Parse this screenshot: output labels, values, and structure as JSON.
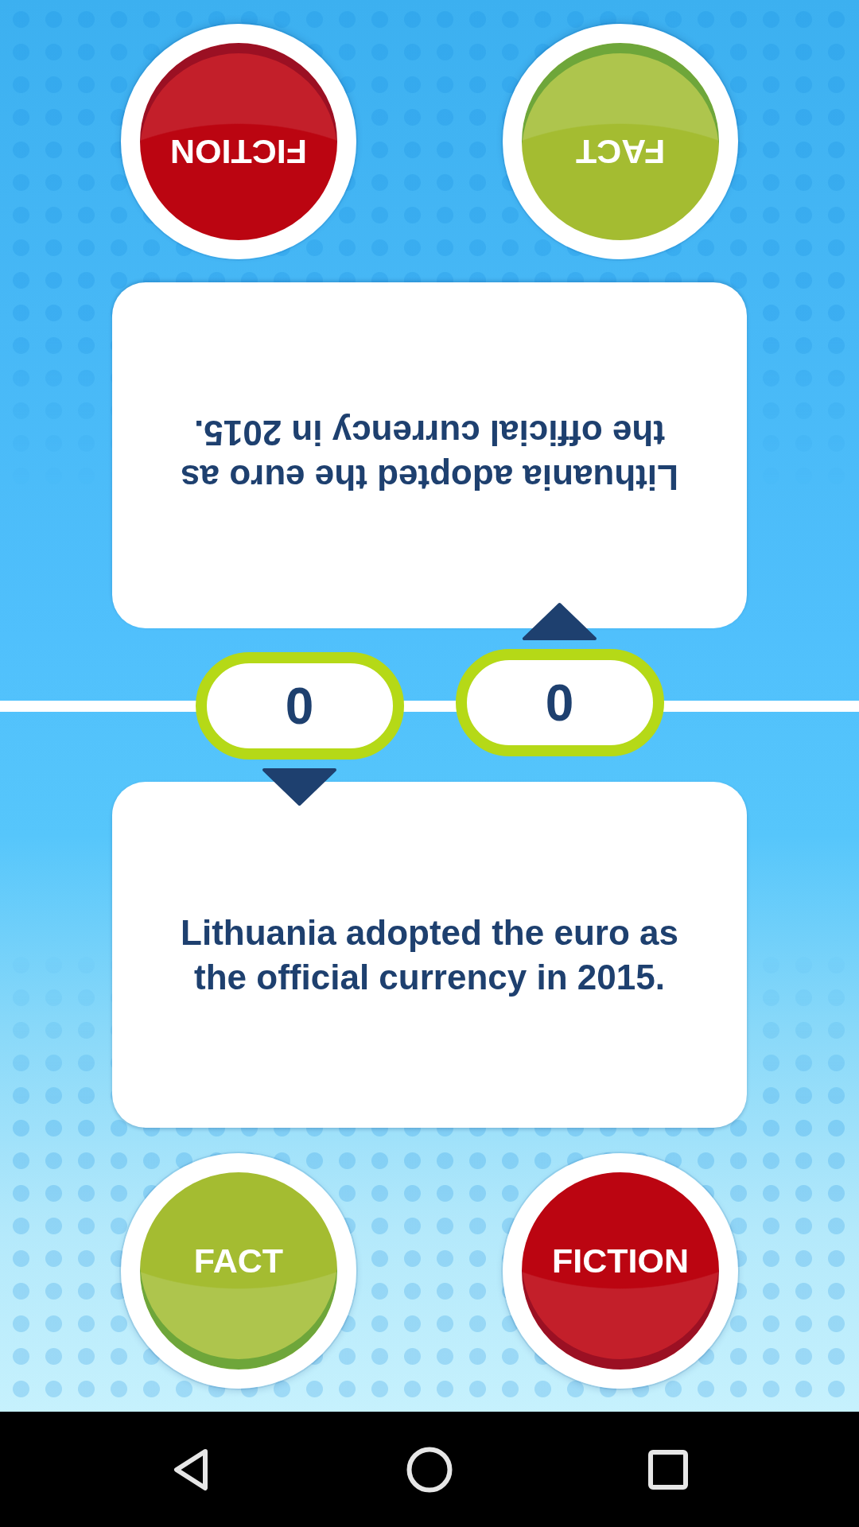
{
  "top_player": {
    "upside_down": true,
    "buttons": [
      {
        "kind": "fiction",
        "label": "FICTION"
      },
      {
        "kind": "fact",
        "label": "FACT"
      }
    ],
    "statement": "Lithuania adopted the euro as the official currency in 2015."
  },
  "scores": [
    {
      "kind": "down",
      "value": "0"
    },
    {
      "kind": "up",
      "value": "0"
    }
  ],
  "bottom_player": {
    "upside_down": false,
    "statement": "Lithuania adopted the euro as the official currency in 2015.",
    "buttons": [
      {
        "kind": "fact",
        "label": "FACT"
      },
      {
        "kind": "fiction",
        "label": "FICTION"
      }
    ]
  }
}
